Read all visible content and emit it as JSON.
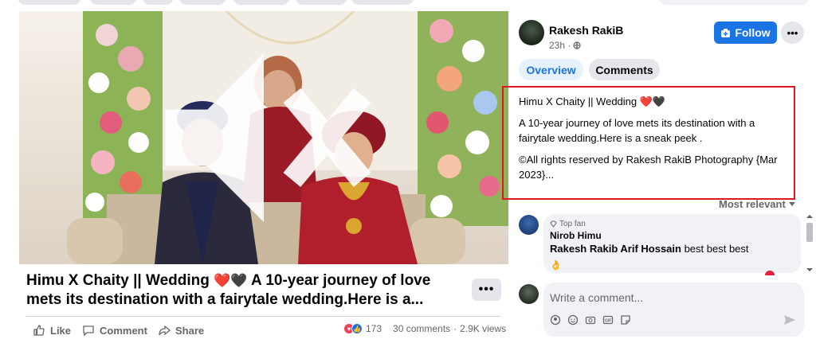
{
  "video": {
    "alt": "",
    "mute_icon": "volume-mute-icon"
  },
  "post": {
    "title_part1": "Himu X Chaity || Wedding ",
    "hearts": "❤️🖤",
    "title_part2": " A 10-year journey of love mets its destination with a fairytale wedding.Here is a...",
    "more_label": "•••"
  },
  "actions": {
    "like": "Like",
    "comment": "Comment",
    "share": "Share"
  },
  "stats": {
    "reaction_count": "173",
    "comments": "30 comments",
    "separator": " · ",
    "views": "2.9K views"
  },
  "author": {
    "name": "Rakesh RakiB",
    "time": "23h ·",
    "follow": "Follow",
    "more": "•••"
  },
  "tabs": [
    {
      "label": "Overview",
      "active": true
    },
    {
      "label": "Comments",
      "active": false
    }
  ],
  "description": {
    "title": "Himu X Chaity || Wedding ❤️🖤",
    "p1": "A 10-year journey of love mets its destination with a fairytale wedding.Here is a sneak peek .",
    "p2": "©All rights reserved by Rakesh RakiB Photography {Mar 2023}..."
  },
  "sort": {
    "label": "Most relevant"
  },
  "comment": {
    "badge": "Top fan",
    "author": "Nirob Himu",
    "tags": "Rakesh Rakib Arif Hossain",
    "text": " best best best",
    "emoji": "👌"
  },
  "composer": {
    "placeholder": "Write a comment..."
  },
  "colors": {
    "accent": "#1b74e4",
    "highlight_border": "#e0171d",
    "muted": "#65676b"
  }
}
